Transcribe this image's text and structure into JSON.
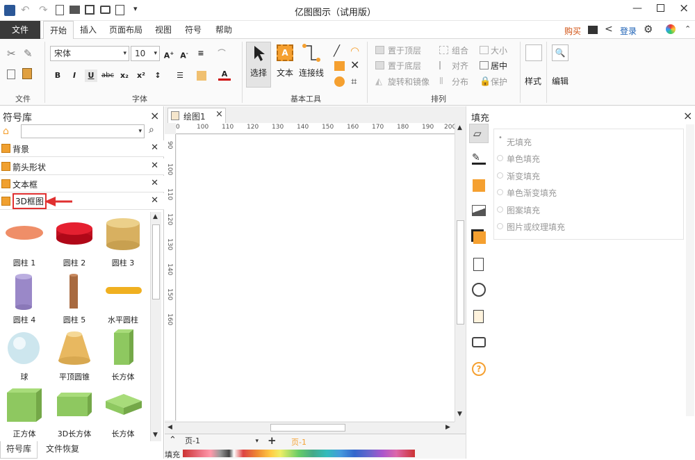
{
  "app": {
    "title": "亿图图示（试用版）"
  },
  "menu": {
    "tabs": [
      "文件",
      "开始",
      "插入",
      "页面布局",
      "视图",
      "符号",
      "帮助"
    ],
    "active_tab": "开始",
    "buy": "购买",
    "login": "登录"
  },
  "ribbon": {
    "groups": {
      "file": "文件",
      "font": "字体",
      "basic_tools": "基本工具",
      "arrange": "排列"
    },
    "font_name": "宋体",
    "font_size": "10",
    "select": "选择",
    "text": "文本",
    "connector": "连接线",
    "arrange_items": [
      "置于顶层",
      "组合",
      "大小",
      "置于底层",
      "对齐",
      "居中",
      "旋转和镜像",
      "分布",
      "保护"
    ],
    "style": "样式",
    "edit": "编辑"
  },
  "symbol_lib": {
    "title": "符号库",
    "libraries": [
      "背景",
      "箭头形状",
      "文本框",
      "3D框图"
    ],
    "shapes": [
      "圆柱 1",
      "圆柱 2",
      "圆柱 3",
      "圆柱 4",
      "圆柱 5",
      "水平圆柱",
      "球",
      "平顶圆锥",
      "长方体",
      "正方体",
      "3D长方体",
      "长方体"
    ],
    "bottom_tabs": [
      "符号库",
      "文件恢复"
    ]
  },
  "document": {
    "tab_title": "绘图1",
    "ruler_h": [
      "0",
      "100",
      "110",
      "120",
      "130",
      "140",
      "150",
      "160",
      "170",
      "180",
      "190",
      "200"
    ],
    "ruler_v": [
      "90",
      "100",
      "110",
      "120",
      "130",
      "140",
      "150",
      "160"
    ],
    "page_select": "页-1",
    "page_tab": "页-1",
    "fill_label": "填充"
  },
  "fill_panel": {
    "title": "填充",
    "options": [
      "无填充",
      "单色填充",
      "渐变填充",
      "单色渐变填充",
      "图案填充",
      "图片或纹理填充"
    ]
  },
  "colors": {
    "accent_orange": "#f5a030",
    "highlight_red": "#e03030",
    "login_blue": "#1a5fb4"
  }
}
